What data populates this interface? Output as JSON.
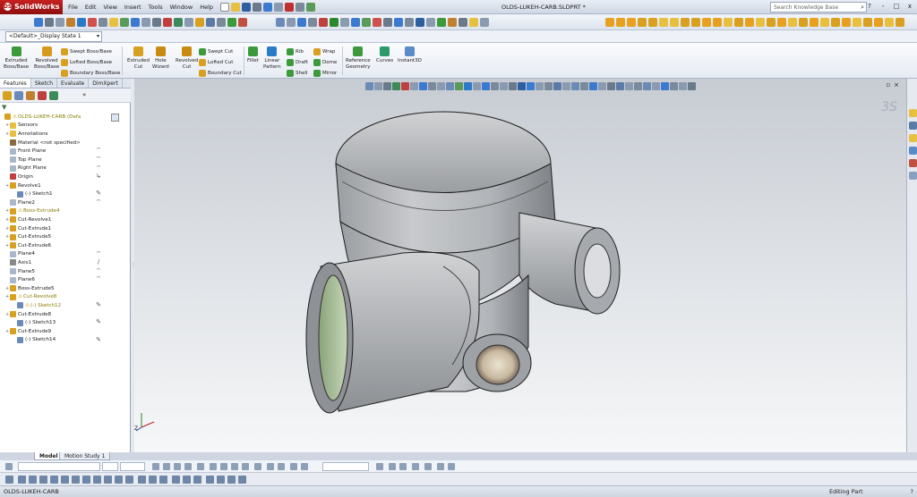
{
  "app": {
    "name": "SolidWorks",
    "menu": [
      "File",
      "Edit",
      "View",
      "Insert",
      "Tools",
      "Window",
      "Help"
    ],
    "document_title": "OLDS-LUKEH-CARB.SLDPRT *",
    "search_placeholder": "Search Knowledge Base",
    "window_buttons": [
      "?",
      "-",
      "□",
      "x"
    ]
  },
  "config": {
    "selected": "<Default>_Display State 1"
  },
  "command_manager": {
    "large": [
      {
        "label": "Extruded\nBoss/Base",
        "color": "#3c9a3c"
      },
      {
        "label": "Revolved\nBoss/Base",
        "color": "#d89a1c"
      },
      {
        "label": "Extruded\nCut",
        "color": "#d8a020"
      },
      {
        "label": "Hole\nWizard",
        "color": "#c88a10"
      },
      {
        "label": "Revolved\nCut",
        "color": "#c88a10"
      },
      {
        "label": "Fillet",
        "color": "#3c9a3c"
      },
      {
        "label": "Linear\nPattern",
        "color": "#2a7ac8"
      },
      {
        "label": "Reference\nGeometry",
        "color": "#3c9a3c"
      },
      {
        "label": "Curves",
        "color": "#2c9a6a"
      },
      {
        "label": "Instant3D",
        "color": "#5a8ac8"
      }
    ],
    "small": [
      {
        "label": "Swept Boss/Base",
        "color": "#d8a020"
      },
      {
        "label": "Lofted Boss/Base",
        "color": "#d8a020"
      },
      {
        "label": "Boundary Boss/Base",
        "color": "#d8a020"
      },
      {
        "label": "Swept Cut",
        "color": "#3c9a3c"
      },
      {
        "label": "Lofted Cut",
        "color": "#d8a020"
      },
      {
        "label": "Boundary Cut",
        "color": "#d8a020"
      },
      {
        "label": "Rib",
        "color": "#3c9a3c"
      },
      {
        "label": "Draft",
        "color": "#3c9a3c"
      },
      {
        "label": "Shell",
        "color": "#3c9a3c"
      },
      {
        "label": "Wrap",
        "color": "#d8a020"
      },
      {
        "label": "Dome",
        "color": "#3c9a3c"
      },
      {
        "label": "Mirror",
        "color": "#3c9a3c"
      }
    ]
  },
  "panel": {
    "tabs": [
      "Features",
      "Sketch",
      "Evaluate",
      "DimXpert"
    ],
    "active_tab": "Features"
  },
  "tree": [
    {
      "label": "OLDS-LUKEH-CARB  (Defa",
      "kind": "root",
      "warn": true
    },
    {
      "label": "Sensors",
      "kind": "folder"
    },
    {
      "label": "Annotations",
      "kind": "folder"
    },
    {
      "label": "Material <not specified>",
      "kind": "material"
    },
    {
      "label": "Front Plane",
      "kind": "plane"
    },
    {
      "label": "Top Plane",
      "kind": "plane"
    },
    {
      "label": "Right Plane",
      "kind": "plane"
    },
    {
      "label": "Origin",
      "kind": "origin"
    },
    {
      "label": "Revolve1",
      "kind": "feature"
    },
    {
      "label": "(-) Sketch1",
      "kind": "sketch"
    },
    {
      "label": "Plane2",
      "kind": "plane"
    },
    {
      "label": "Boss-Extrude4",
      "kind": "feature",
      "warn": true
    },
    {
      "label": "Cut-Revolve1",
      "kind": "feature"
    },
    {
      "label": "Cut-Extrude1",
      "kind": "feature"
    },
    {
      "label": "Cut-Extrude5",
      "kind": "feature"
    },
    {
      "label": "Cut-Extrude6",
      "kind": "feature"
    },
    {
      "label": "Plane4",
      "kind": "plane"
    },
    {
      "label": "Axis1",
      "kind": "axis"
    },
    {
      "label": "Plane5",
      "kind": "plane"
    },
    {
      "label": "Plane6",
      "kind": "plane"
    },
    {
      "label": "Boss-Extrude5",
      "kind": "feature"
    },
    {
      "label": "Cut-Revolve8",
      "kind": "feature",
      "warn": true
    },
    {
      "label": "(-) Sketch12",
      "kind": "sketch",
      "warn": true
    },
    {
      "label": "Cut-Extrude8",
      "kind": "feature"
    },
    {
      "label": "(-) Sketch13",
      "kind": "sketch"
    },
    {
      "label": "Cut-Extrude9",
      "kind": "feature"
    },
    {
      "label": "(-) Sketch14",
      "kind": "sketch"
    }
  ],
  "bottom_tabs": [
    "Model",
    "Motion Study 1"
  ],
  "status": {
    "left": "OLDS-LUKEH-CARB",
    "right": "Editing Part",
    "help": "?"
  },
  "viewport": {
    "triad_label": "Z",
    "ds_mark": "3S"
  }
}
